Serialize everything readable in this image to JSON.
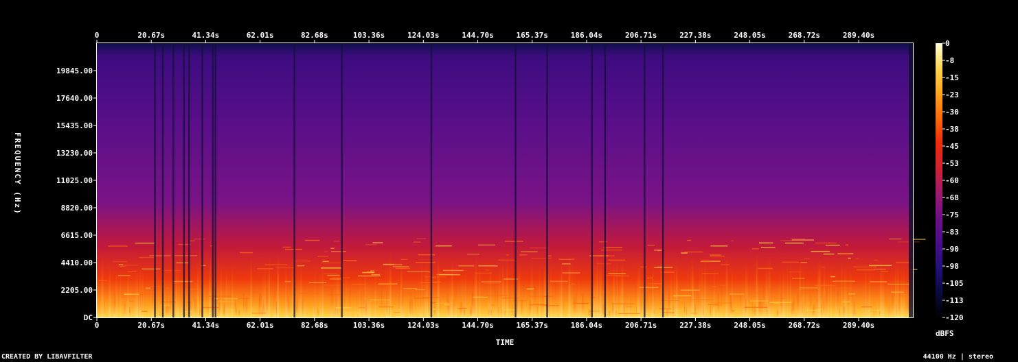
{
  "chart_data": {
    "type": "heatmap",
    "xlabel": "TIME",
    "ylabel": "FREQUENCY (Hz)",
    "x_ticks": [
      "0",
      "20.67s",
      "41.34s",
      "62.01s",
      "82.68s",
      "103.36s",
      "124.03s",
      "144.70s",
      "165.37s",
      "186.04s",
      "206.71s",
      "227.38s",
      "248.05s",
      "268.72s",
      "289.40s"
    ],
    "x_tick_values": [
      0,
      20.67,
      41.34,
      62.01,
      82.68,
      103.36,
      124.03,
      144.7,
      165.37,
      186.04,
      206.71,
      227.38,
      248.05,
      268.72,
      289.4
    ],
    "xlim": [
      0,
      310
    ],
    "y_ticks": [
      "DC",
      "2205.00",
      "4410.00",
      "6615.00",
      "8820.00",
      "11025.00",
      "13230.00",
      "15435.00",
      "17640.00",
      "19845.00"
    ],
    "y_tick_values": [
      0,
      2205,
      4410,
      6615,
      8820,
      11025,
      13230,
      15435,
      17640,
      19845
    ],
    "ylim": [
      0,
      22050
    ],
    "colorbar": {
      "label": "dBFS",
      "ticks": [
        "0",
        "-8",
        "-15",
        "-23",
        "-30",
        "-38",
        "-45",
        "-53",
        "-60",
        "-68",
        "-75",
        "-83",
        "-90",
        "-98",
        "-105",
        "-113",
        "-120"
      ],
      "range": [
        -120,
        0
      ],
      "colors": [
        "#000000",
        "#0a0a40",
        "#24107a",
        "#4a0e8a",
        "#6e0f86",
        "#a01a6e",
        "#d02230",
        "#ee2a0a",
        "#fb6a0a",
        "#ffa51e",
        "#ffd650",
        "#ffffd8"
      ]
    },
    "quiet_gaps_s": [
      22,
      25,
      29,
      33,
      35,
      40,
      44,
      45,
      75,
      93,
      127,
      159,
      171,
      188,
      193,
      208,
      215
    ]
  },
  "footer": {
    "left": "CREATED BY LIBAVFILTER",
    "right": "44100 Hz | stereo"
  }
}
